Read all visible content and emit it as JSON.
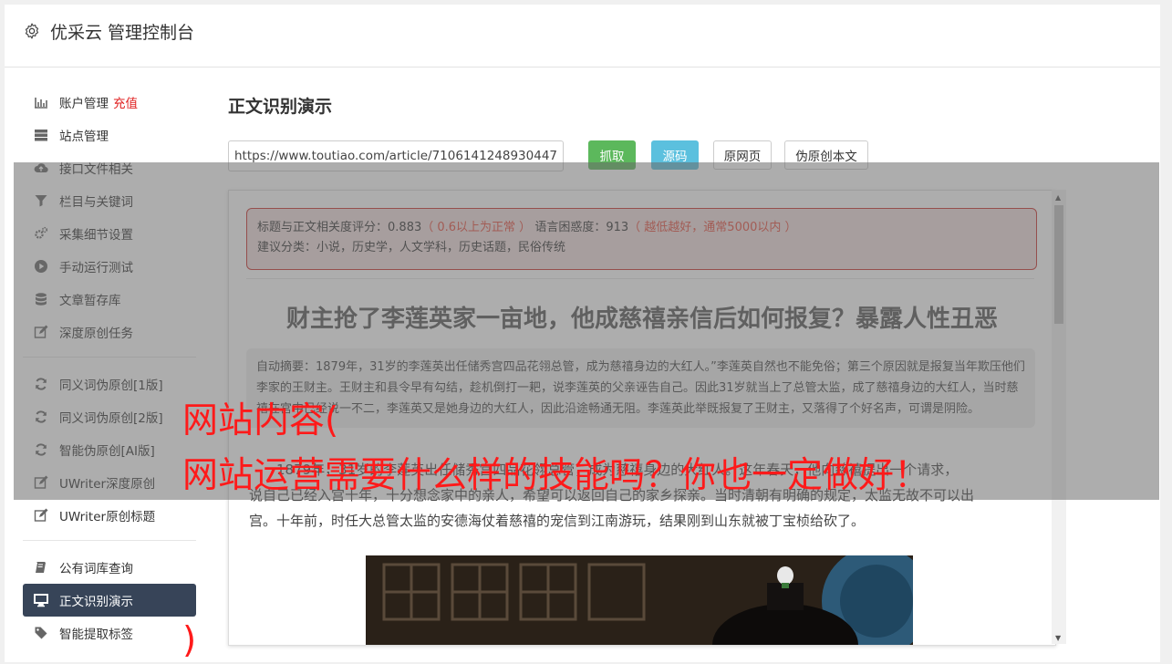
{
  "header": {
    "title": "优采云 管理控制台",
    "icon": "gear-icon"
  },
  "sidebar": {
    "group1": [
      {
        "label": "账户管理",
        "extra": "充值",
        "icon": "bar-chart-icon"
      },
      {
        "label": "站点管理",
        "icon": "server-icon"
      },
      {
        "label": "接口文件相关",
        "icon": "cloud-upload-icon"
      },
      {
        "label": "栏目与关键词",
        "icon": "filter-icon"
      },
      {
        "label": "采集细节设置",
        "icon": "cogs-icon"
      },
      {
        "label": "手动运行测试",
        "icon": "play-circle-icon"
      },
      {
        "label": "文章暂存库",
        "icon": "database-icon"
      },
      {
        "label": "深度原创任务",
        "icon": "edit-icon"
      }
    ],
    "group2": [
      {
        "label": "同义词伪原创[1版]",
        "icon": "refresh-icon"
      },
      {
        "label": "同义词伪原创[2版]",
        "icon": "refresh-icon"
      },
      {
        "label": "智能伪原创[AI版]",
        "icon": "refresh-icon"
      },
      {
        "label": "UWriter深度原创",
        "icon": "edit-icon"
      },
      {
        "label": "UWriter原创标题",
        "icon": "edit-icon"
      }
    ],
    "group3": [
      {
        "label": "公有词库查询",
        "icon": "book-icon"
      },
      {
        "label": "正文识别演示",
        "icon": "desktop-icon"
      },
      {
        "label": "智能提取标签",
        "icon": "tag-icon"
      }
    ]
  },
  "main": {
    "title": "正文识别演示",
    "url_value": "https://www.toutiao.com/article/7106141248930447",
    "buttons": {
      "fetch": "抓取",
      "source": "源码",
      "original": "原网页",
      "fake_original": "伪原创本文"
    }
  },
  "result": {
    "score_label": "标题与正文相关度评分：",
    "score_value": "0.883",
    "score_hint": "（ 0.6以上为正常 ）",
    "confusion_label": "语言困惑度：",
    "confusion_value": "913",
    "confusion_hint": "（ 越低越好，通常5000以内 ）",
    "category_label": "建议分类：",
    "categories": "小说，历史学，人文学科，历史话题，民俗传统",
    "article_title": "财主抢了李莲英家一亩地，他成慈禧亲信后如何报复？暴露人性丑恶",
    "summary": "自动摘要：1879年，31岁的李莲英出任储秀宫四品花翎总管，成为慈禧身边的大红人。”李莲英自然也不能免俗；第三个原因就是报复当年欺压他们李家的王财主。王财主和县令早有勾结，趁机倒打一耙，说李莲英的父亲诬告自己。因此31岁就当上了总管太监，成了慈禧身边的大红人，当时慈禧在宫中已经说一不二，李莲英又是她身边的大红人，因此沿途畅通无阻。李莲英此举既报复了王财主，又落得了个好名声，可谓是阴险。",
    "body_line1": "1879年，31岁的李莲英出任储秀宫四品花翎总管，成为慈禧身边的大红人。这年春天，他向慈禧提出一个请求，",
    "body_line2": "说自己已经入宫十年，十分想念家中的亲人，希望可以返回自己的家乡探亲。当时清朝有明确的规定，太监无故不可以出",
    "body_line3": "宫。十年前，时任大总管太监的安德海仗着慈禧的宠信到江南游玩，结果刚到山东就被丁宝桢给砍了。"
  },
  "overlay": {
    "line1": "网站内容(",
    "line2": "网站运营需要什么样的技能吗？你也一定做好！",
    "line3": ")",
    "color": "#ff1a1a"
  }
}
